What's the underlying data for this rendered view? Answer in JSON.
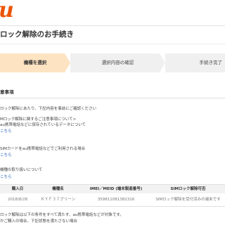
{
  "brand": {
    "logo_text": "u",
    "accent": "#eb5505"
  },
  "page": {
    "title": "ロック解除のお手続き"
  },
  "steps": [
    {
      "label": "機種を選択",
      "active": true
    },
    {
      "label": "選択内容の確認",
      "active": false
    },
    {
      "label": "手続き完了",
      "active": false
    }
  ],
  "notes": {
    "heading": "意事項",
    "line1": "ロック解除にあたり、下記内容を事前にご確認ください",
    "line2": "Mロック解除に関するご注意事項について>",
    "line3": "au携帯電話などに保存されているデータについて",
    "link1": "こちら",
    "line4": "SIMカードをau携帯電話などでご利用される場合",
    "link2": "こちら",
    "line5": "機種の取り扱いについて",
    "link3": "こちら"
  },
  "table": {
    "headers": [
      "購入日",
      "機種名",
      "IMEI／MEID (端末製造番号)",
      "SIMロック解除可否"
    ],
    "rows": [
      [
        "2018/8/28",
        "ＫＹＦ３７グリーン",
        "359811081382316",
        "SIMロック解除を受付済みの端末です"
      ]
    ]
  },
  "footer": {
    "line1": "ロック解除は以下の条件をすべて満たす、au携帯電話などが対象です。",
    "line2": "かご購入の場合、下記状態を満たさない場合"
  }
}
